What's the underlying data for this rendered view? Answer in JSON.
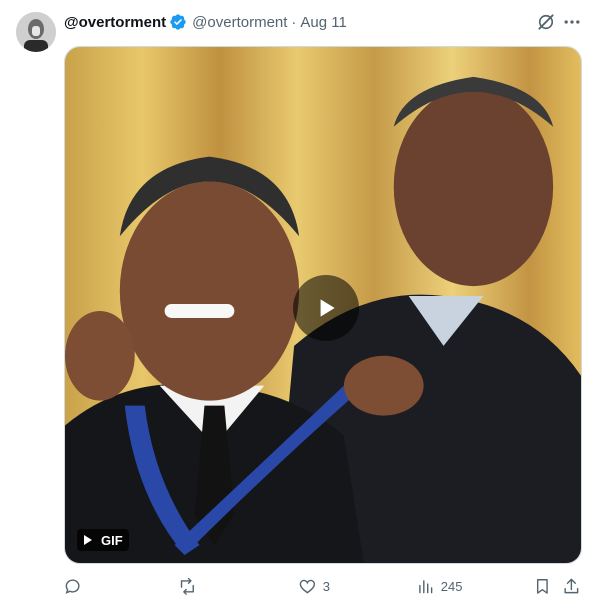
{
  "tweet": {
    "display_name": "@overtorment",
    "handle": "@overtorment",
    "separator": "·",
    "date": "Aug 11",
    "media": {
      "badge": "GIF",
      "kind": "animated-gif"
    },
    "actions": {
      "reply_count": "",
      "retweet_count": "",
      "like_count": "3",
      "view_count": "245"
    }
  },
  "icons": {
    "verified": "verified-badge-icon",
    "grok": "grok-icon",
    "more": "more-icon",
    "play": "play-icon",
    "reply": "reply-icon",
    "retweet": "retweet-icon",
    "like": "heart-icon",
    "views": "analytics-icon",
    "bookmark": "bookmark-icon",
    "share": "share-icon"
  },
  "colors": {
    "brand_blue": "#1d9bf0",
    "secondary_text": "#536471",
    "primary_text": "#0f1419"
  }
}
